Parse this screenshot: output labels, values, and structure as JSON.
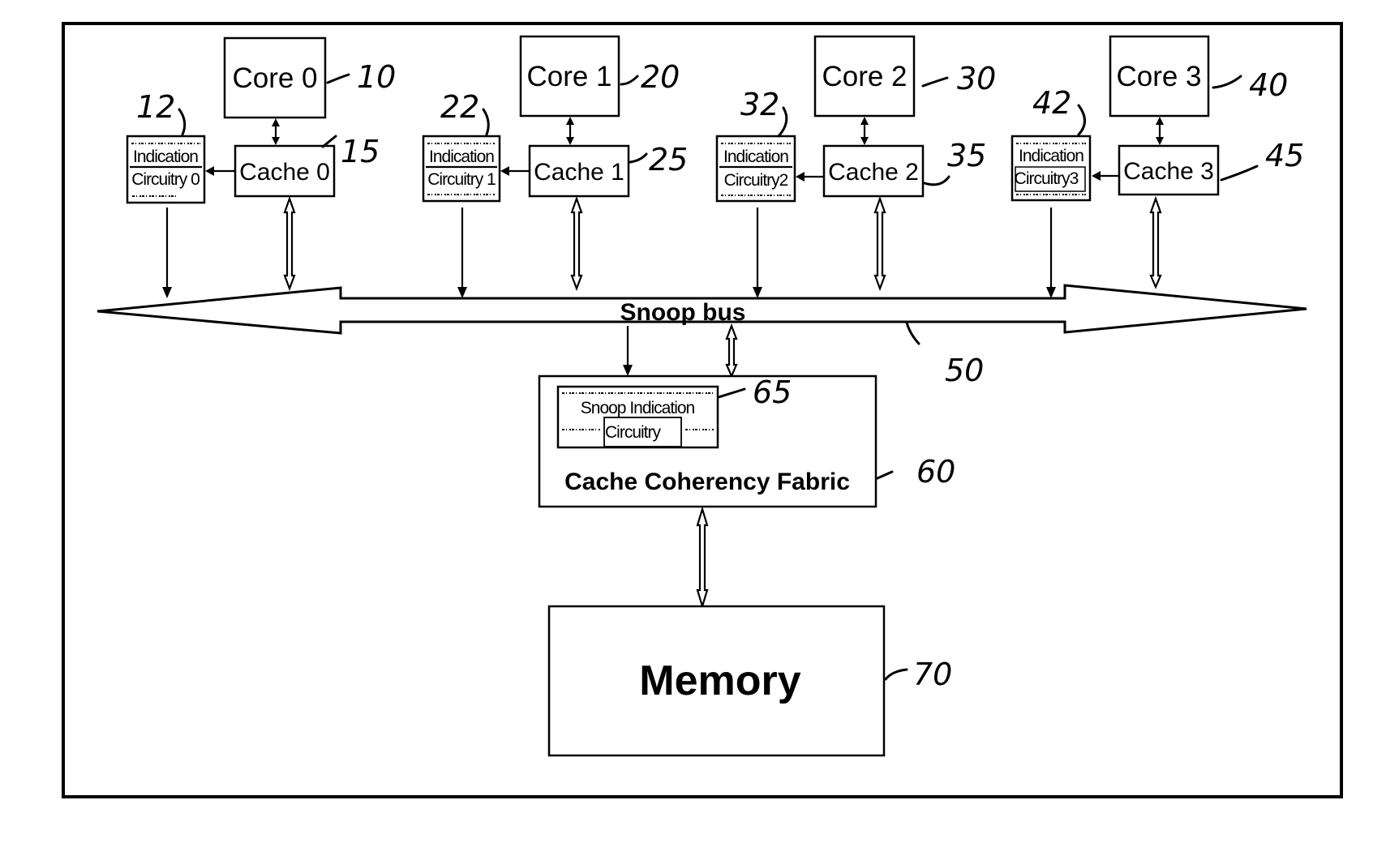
{
  "figure": {
    "bus_label": "Snoop bus",
    "bus_ref": "50",
    "fabric": {
      "label": "Cache Coherency Fabric",
      "ref": "60",
      "snoop_indication_line1": "Snoop Indication",
      "snoop_indication_line2": "Circuitry",
      "snoop_indication_ref": "65"
    },
    "memory": {
      "label": "Memory",
      "ref": "70"
    },
    "units": [
      {
        "core": "Core 0",
        "core_ref": "10",
        "cache": "Cache 0",
        "cache_ref": "15",
        "ind_line1": "Indication",
        "ind_line2": "Circuitry 0",
        "ind_ref": "12"
      },
      {
        "core": "Core 1",
        "core_ref": "20",
        "cache": "Cache 1",
        "cache_ref": "25",
        "ind_line1": "Indication",
        "ind_line2": "Circuitry 1",
        "ind_ref": "22"
      },
      {
        "core": "Core 2",
        "core_ref": "30",
        "cache": "Cache 2",
        "cache_ref": "35",
        "ind_line1": "Indication",
        "ind_line2": "Circuitry2",
        "ind_ref": "32"
      },
      {
        "core": "Core 3",
        "core_ref": "40",
        "cache": "Cache 3",
        "cache_ref": "45",
        "ind_line1": "Indication",
        "ind_line2": "Circuitry3",
        "ind_ref": "42"
      }
    ]
  }
}
